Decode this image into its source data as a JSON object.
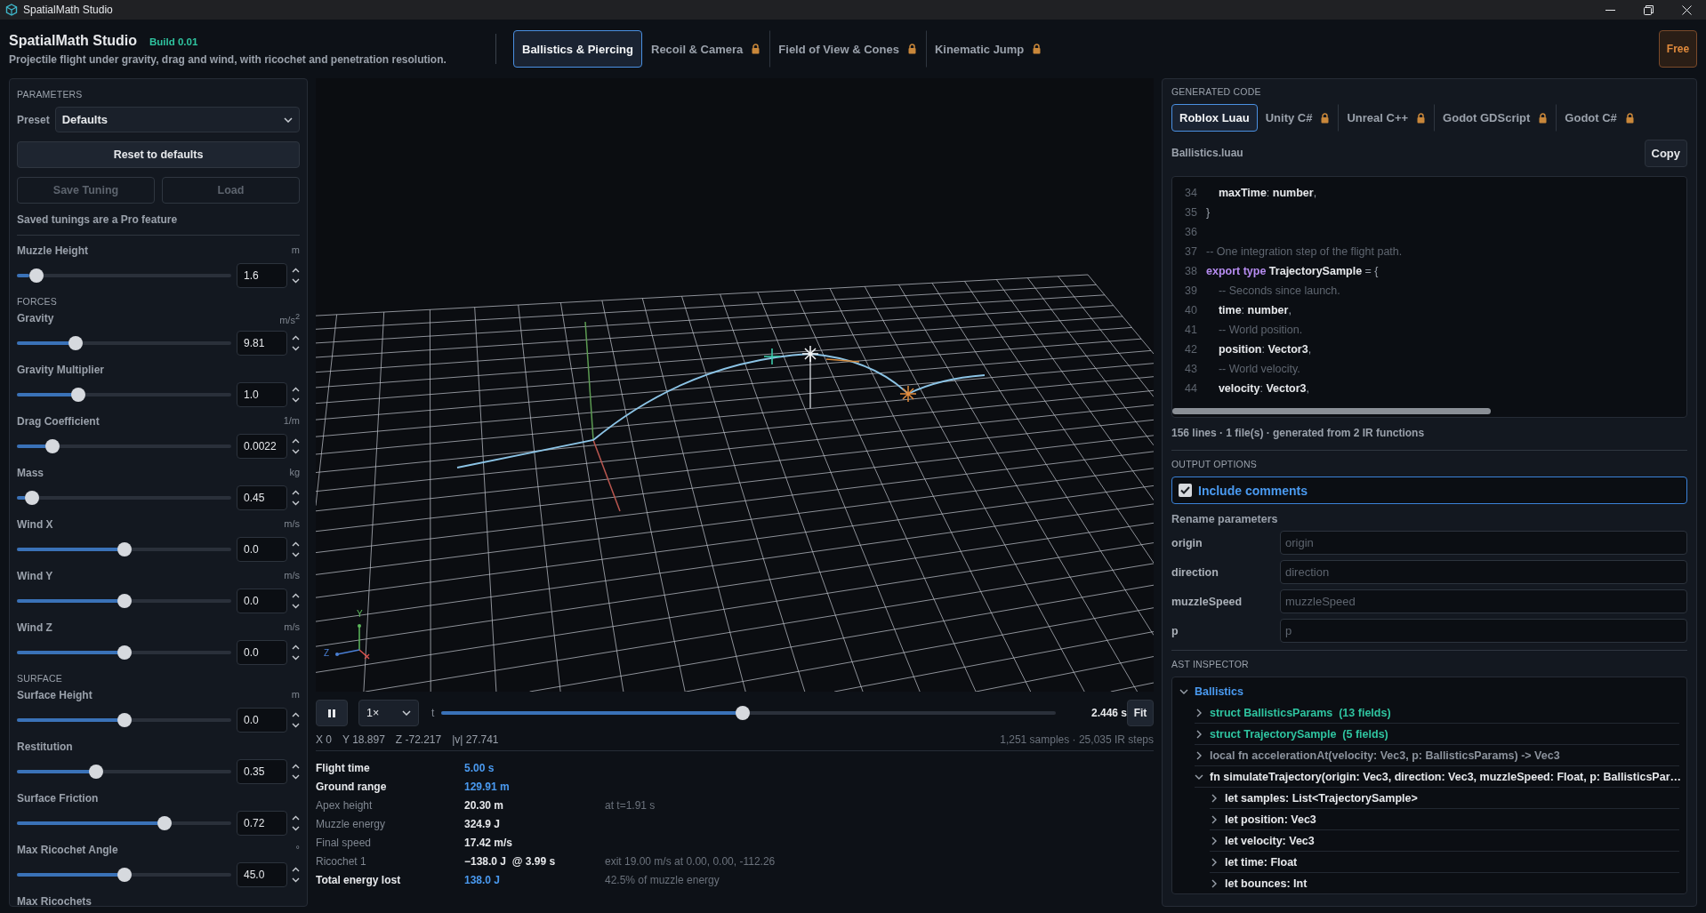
{
  "window": {
    "title": "SpatialMath Studio"
  },
  "header": {
    "title": "SpatialMath Studio",
    "build": "Build 0.01",
    "subtitle": "Projectile flight under gravity, drag and wind, with ricochet and penetration resolution.",
    "tabs": [
      {
        "label": "Ballistics & Piercing",
        "selected": true,
        "locked": false
      },
      {
        "label": "Recoil & Camera",
        "selected": false,
        "locked": true
      },
      {
        "label": "Field of View & Cones",
        "selected": false,
        "locked": true
      },
      {
        "label": "Kinematic Jump",
        "selected": false,
        "locked": true
      }
    ],
    "plan": "Free"
  },
  "parameters": {
    "heading": "PARAMETERS",
    "preset_label": "Preset",
    "preset": "Defaults",
    "reset": "Reset to defaults",
    "buttons": [
      {
        "label": "Save Tuning",
        "disabled": true
      },
      {
        "label": "Load",
        "disabled": true
      }
    ],
    "note": "Saved tunings are a Pro feature",
    "items": [
      {
        "kind": "slider",
        "label": "Muzzle Height",
        "unit": "m",
        "level": 0.06,
        "value": "1.6"
      },
      {
        "kind": "heading",
        "label": "FORCES"
      },
      {
        "kind": "slider",
        "label": "Gravity",
        "unit": "m/s$^{2}$",
        "level": 0.26,
        "value": "9.81"
      },
      {
        "kind": "slider",
        "label": "Gravity Multiplier",
        "level": 0.27,
        "value": "1.0"
      },
      {
        "kind": "slider",
        "label": "Drag Coefficient",
        "unit": "1/m",
        "level": 0.14,
        "value": "0.0022"
      },
      {
        "kind": "slider",
        "label": "Mass",
        "unit": "kg",
        "level": 0.04,
        "value": "0.45"
      },
      {
        "kind": "slider",
        "label": "Wind X",
        "unit": "m/s",
        "level": 0.5,
        "value": "0.0"
      },
      {
        "kind": "slider",
        "label": "Wind Y",
        "unit": "m/s",
        "level": 0.5,
        "value": "0.0"
      },
      {
        "kind": "slider",
        "label": "Wind Z",
        "unit": "m/s",
        "level": 0.5,
        "value": "0.0"
      },
      {
        "kind": "heading",
        "label": "SURFACE"
      },
      {
        "kind": "slider",
        "label": "Surface Height",
        "unit": "m",
        "level": 0.5,
        "value": "0.0"
      },
      {
        "kind": "slider",
        "label": "Restitution",
        "level": 0.36,
        "value": "0.35"
      },
      {
        "kind": "slider",
        "label": "Surface Friction",
        "level": 0.7,
        "value": "0.72"
      },
      {
        "kind": "slider",
        "label": "Max Ricochet Angle",
        "unit": "°",
        "level": 0.5,
        "value": "45.0"
      },
      {
        "kind": "label",
        "label": "Max Ricochets"
      }
    ]
  },
  "viewport": {
    "gizmo_labels": [
      "Y",
      "Z"
    ],
    "playing": true,
    "speed": "1×",
    "time_label": "t",
    "level": 0.49,
    "time": "2.446 s",
    "fit": "Fit",
    "readouts": [
      "X 0",
      "Y 18.897",
      "Z -72.217",
      "|v| 27.741"
    ],
    "sample_info": "1,251 samples · 25,035 IR steps"
  },
  "results": [
    {
      "label": "Flight time",
      "value": "5.00 s",
      "highlight": true
    },
    {
      "label": "Ground range",
      "value": "129.91 m",
      "highlight": true
    },
    {
      "label": "Apex height",
      "value": "20.30 m",
      "note": "at t=1.91 s",
      "highlight": false
    },
    {
      "label": "Muzzle energy",
      "value": "324.9 J",
      "highlight": false
    },
    {
      "label": "Final speed",
      "value": "17.42 m/s",
      "highlight": false
    },
    {
      "label": "Ricochet 1",
      "value": "−138.0 J  @ 3.99 s",
      "note": "exit 19.00 m/s at 0.00, 0.00, -112.26",
      "highlight": false
    },
    {
      "label": "Total energy lost",
      "value": "138.0 J",
      "note": "42.5% of muzzle energy",
      "highlight": true
    }
  ],
  "code": {
    "heading": "GENERATED CODE",
    "tabs": [
      {
        "label": "Roblox Luau",
        "selected": true,
        "locked": false
      },
      {
        "label": "Unity C#",
        "selected": false,
        "locked": true
      },
      {
        "label": "Unreal C++",
        "selected": false,
        "locked": true
      },
      {
        "label": "Godot GDScript",
        "selected": false,
        "locked": true
      },
      {
        "label": "Godot C#",
        "selected": false,
        "locked": true
      }
    ],
    "filename": "Ballistics.luau",
    "copy": "Copy",
    "lines": [
      {
        "n": "34",
        "tokens": [
          {
            "text": "    maxTime",
            "kind": "identifier"
          },
          {
            "text": ":",
            "kind": "punctuation"
          },
          {
            "text": " number",
            "kind": "identifier"
          },
          {
            "text": ",",
            "kind": "punctuation"
          }
        ]
      },
      {
        "n": "35",
        "tokens": [
          {
            "text": "}",
            "kind": "punctuation"
          }
        ]
      },
      {
        "n": "36"
      },
      {
        "n": "37",
        "tokens": [
          {
            "text": "-- One integration step of the flight path.",
            "kind": "comment"
          }
        ]
      },
      {
        "n": "38",
        "tokens": [
          {
            "text": "export type",
            "kind": "keyword"
          },
          {
            "text": " TrajectorySample",
            "kind": "identifier"
          },
          {
            "text": " = {",
            "kind": "punctuation"
          }
        ]
      },
      {
        "n": "39",
        "tokens": [
          {
            "text": "    -- Seconds since launch.",
            "kind": "comment"
          }
        ]
      },
      {
        "n": "40",
        "tokens": [
          {
            "text": "    time",
            "kind": "identifier"
          },
          {
            "text": ":",
            "kind": "punctuation"
          },
          {
            "text": " number",
            "kind": "identifier"
          },
          {
            "text": ",",
            "kind": "punctuation"
          }
        ]
      },
      {
        "n": "41",
        "tokens": [
          {
            "text": "    -- World position.",
            "kind": "comment"
          }
        ]
      },
      {
        "n": "42",
        "tokens": [
          {
            "text": "    position",
            "kind": "identifier"
          },
          {
            "text": ":",
            "kind": "punctuation"
          },
          {
            "text": " Vector3",
            "kind": "identifier"
          },
          {
            "text": ",",
            "kind": "punctuation"
          }
        ]
      },
      {
        "n": "43",
        "tokens": [
          {
            "text": "    -- World velocity.",
            "kind": "comment"
          }
        ]
      },
      {
        "n": "44",
        "tokens": [
          {
            "text": "    velocity",
            "kind": "identifier"
          },
          {
            "text": ":",
            "kind": "punctuation"
          },
          {
            "text": " Vector3",
            "kind": "identifier"
          },
          {
            "text": ",",
            "kind": "punctuation"
          }
        ]
      }
    ],
    "summary": "156 lines · 1 file(s) · generated from 2 IR functions"
  },
  "options": {
    "heading": "OUTPUT OPTIONS",
    "include_comments": {
      "label": "Include comments",
      "checked": true
    },
    "rename_label": "Rename parameters",
    "renames": [
      {
        "name": "origin",
        "placeholder": "origin"
      },
      {
        "name": "direction",
        "placeholder": "direction"
      },
      {
        "name": "muzzleSpeed",
        "placeholder": "muzzleSpeed"
      },
      {
        "name": "p",
        "placeholder": "p"
      }
    ]
  },
  "ast": {
    "heading": "AST INSPECTOR",
    "tree": [
      {
        "label": "Ballistics",
        "kind": "module",
        "expanded": true,
        "children": [
          {
            "label": "struct BallisticsParams  (13 fields)",
            "kind": "struct",
            "expanded": false
          },
          {
            "label": "struct TrajectorySample  (5 fields)",
            "kind": "struct",
            "expanded": false
          },
          {
            "label": "local fn accelerationAt(velocity: Vec3, p: BallisticsParams) -> Vec3",
            "kind": "local_fn",
            "expanded": false
          },
          {
            "label": "fn simulateTrajectory(origin: Vec3, direction: Vec3, muzzleSpeed: Float, p: BallisticsPar…",
            "kind": "fn",
            "expanded": true,
            "children": [
              {
                "label": "let samples: List<TrajectorySample>",
                "expanded": false
              },
              {
                "label": "let position: Vec3",
                "expanded": false
              },
              {
                "label": "let velocity: Vec3",
                "expanded": false
              },
              {
                "label": "let time: Float",
                "expanded": false
              },
              {
                "label": "let bounces: Int",
                "expanded": false
              }
            ]
          }
        ]
      }
    ]
  }
}
